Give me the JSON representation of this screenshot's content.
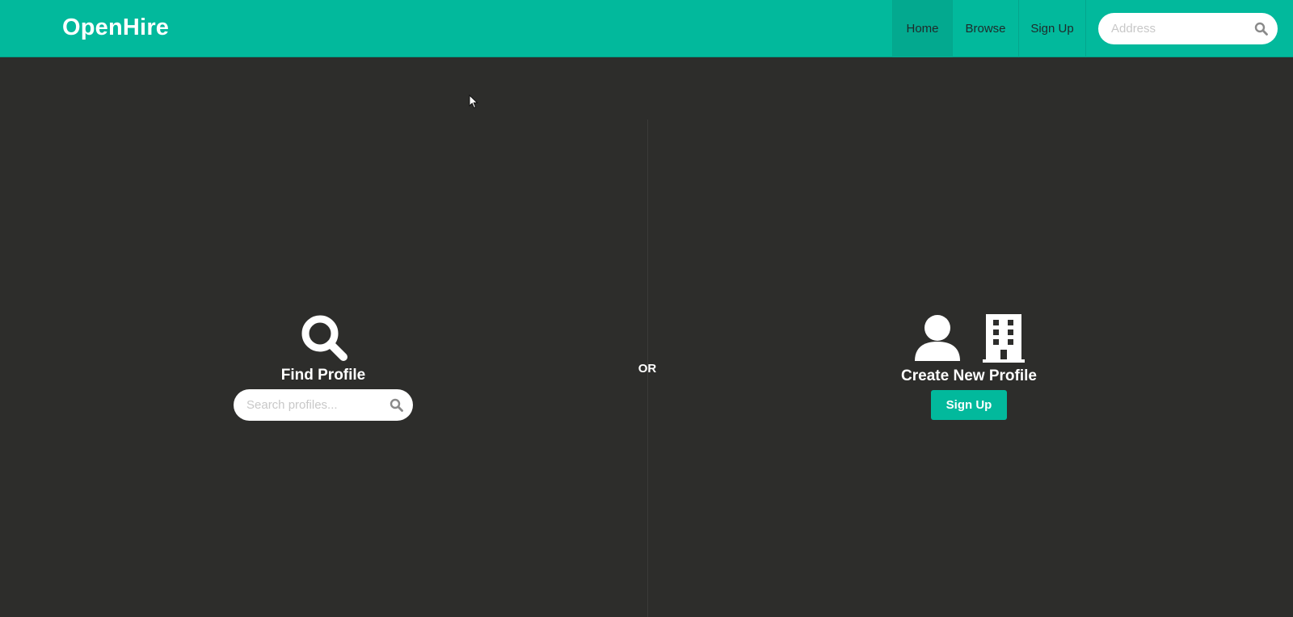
{
  "navbar": {
    "brand": "OpenHire",
    "links": [
      {
        "label": "Home",
        "active": true
      },
      {
        "label": "Browse",
        "active": false
      },
      {
        "label": "Sign Up",
        "active": false
      }
    ],
    "address_search": {
      "placeholder": "Address",
      "value": "",
      "icon": "search-icon"
    }
  },
  "main": {
    "find": {
      "icon": "search-icon",
      "title": "Find Profile",
      "search": {
        "placeholder": "Search profiles...",
        "value": "",
        "icon": "search-icon"
      }
    },
    "or_label": "OR",
    "create": {
      "icons": [
        "person-icon",
        "building-icon"
      ],
      "title": "Create New Profile",
      "button_label": "Sign Up"
    }
  },
  "colors": {
    "accent": "#02b99c",
    "background": "#2d2d2b",
    "text": "#ffffff"
  }
}
